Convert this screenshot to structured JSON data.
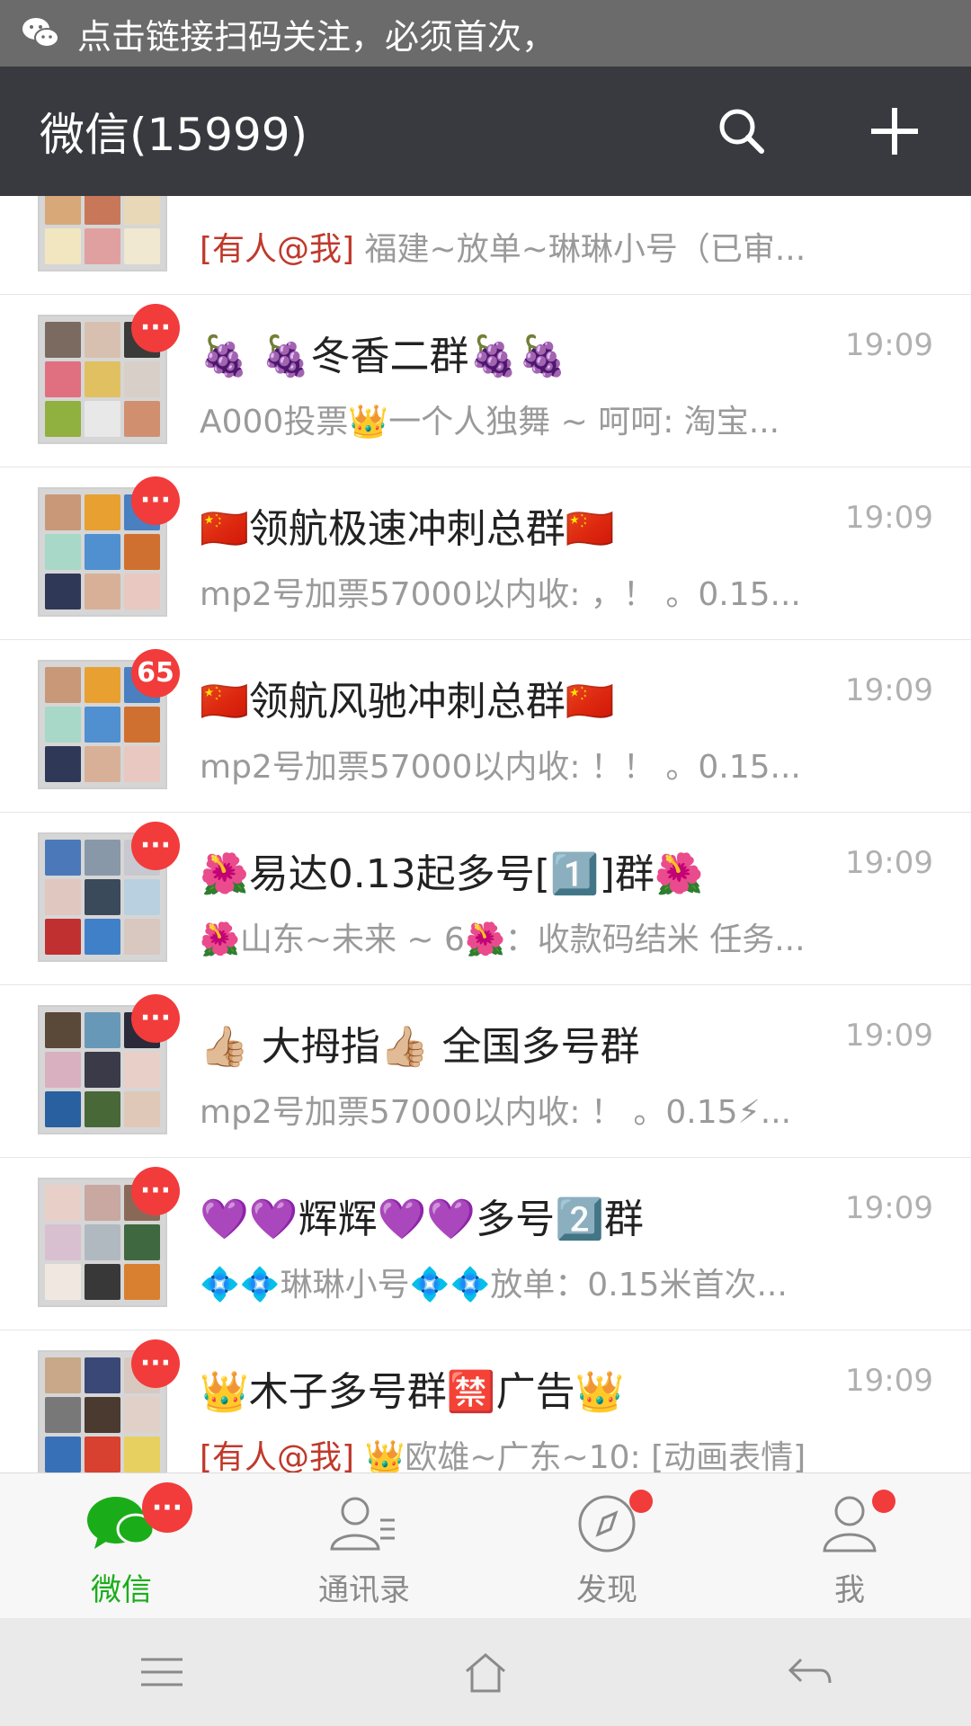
{
  "notification": {
    "text": "点击链接扫码关注，必须首次，"
  },
  "header": {
    "title": "微信(15999)"
  },
  "chats": [
    {
      "name": "",
      "preview_mention": "[有人@我]",
      "preview": " 福建~放单~琳琳小号（已审...",
      "time": "",
      "badge": ""
    },
    {
      "name": "🍇 🍇冬香二群🍇🍇",
      "preview_mention": "",
      "preview": "A000投票👑一个人独舞 ~ 呵呵: 淘宝...",
      "time": "19:09",
      "badge": "···"
    },
    {
      "name": "🇨🇳领航极速冲刺总群🇨🇳",
      "preview_mention": "",
      "preview": "mp2号加票57000以内收: ，！ 。0.15...",
      "time": "19:09",
      "badge": "···"
    },
    {
      "name": "🇨🇳领航风驰冲刺总群🇨🇳",
      "preview_mention": "",
      "preview": "mp2号加票57000以内收: ！！ 。0.15...",
      "time": "19:09",
      "badge": "65"
    },
    {
      "name": "🌺易达0.13起多号[1️⃣]群🌺",
      "preview_mention": "",
      "preview": "🌺山东~未来 ~ 6🌺：收款码结米 任务...",
      "time": "19:09",
      "badge": "···"
    },
    {
      "name": "👍🏼 大拇指👍🏼 全国多号群",
      "preview_mention": "",
      "preview": "mp2号加票57000以内收: ！ 。0.15⚡...",
      "time": "19:09",
      "badge": "···"
    },
    {
      "name": "💜💜辉辉💜💜多号2️⃣群",
      "preview_mention": "",
      "preview": "💠💠琳琳小号💠💠放单：0.15米首次...",
      "time": "19:09",
      "badge": "···"
    },
    {
      "name": "👑木子多号群🈲广告👑",
      "preview_mention": "[有人@我]",
      "preview": " 👑欧雄~广东~10: [动画表情]",
      "time": "19:09",
      "badge": "···"
    }
  ],
  "tabs": [
    {
      "label": "微信",
      "badge": "···"
    },
    {
      "label": "通讯录"
    },
    {
      "label": "发现"
    },
    {
      "label": "我"
    }
  ],
  "colors": {
    "header_bg": "#393a3f",
    "accent": "#1aad19",
    "badge": "#f23b3b",
    "mention": "#c0392b"
  }
}
